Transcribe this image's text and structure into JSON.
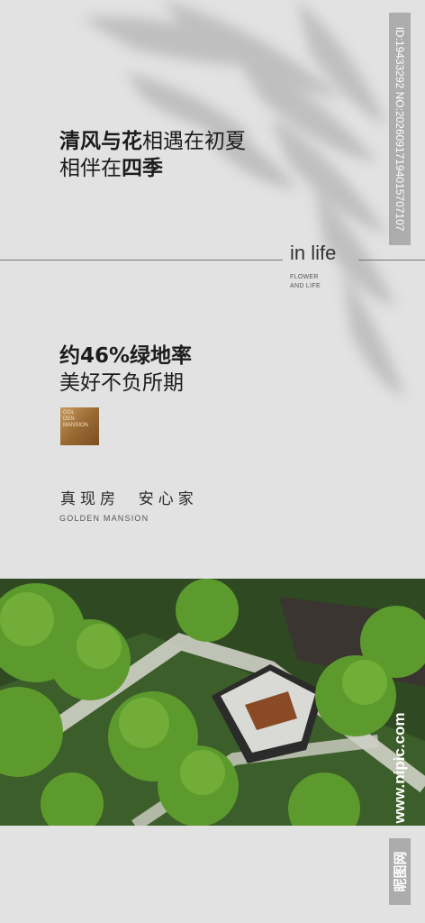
{
  "headline": {
    "line1_bold": "清风与花",
    "line1_rest": "相遇在初夏",
    "line2_rest": "相伴在",
    "line2_bold": "四季"
  },
  "inlife": {
    "title": "in life",
    "sub1": "FLOWER",
    "sub2": "AND LIFE"
  },
  "green": {
    "rate": "约46%绿地率",
    "slogan": "美好不负所期"
  },
  "logo": {
    "line1": "GOL",
    "line2": "DEN",
    "line3": "MANSION"
  },
  "tagline": "真现房  安心家",
  "brand_en": "GOLDEN MANSION",
  "watermark": {
    "id": "ID:19433292 NO:20260917194015707107",
    "url": "www.nipic.com",
    "site": "昵图网"
  },
  "photo": {
    "icon": "garden-aerial-photo"
  },
  "colors": {
    "background": "#e2e2e2",
    "text": "#1c1c1c",
    "gold": "#b07f43"
  }
}
